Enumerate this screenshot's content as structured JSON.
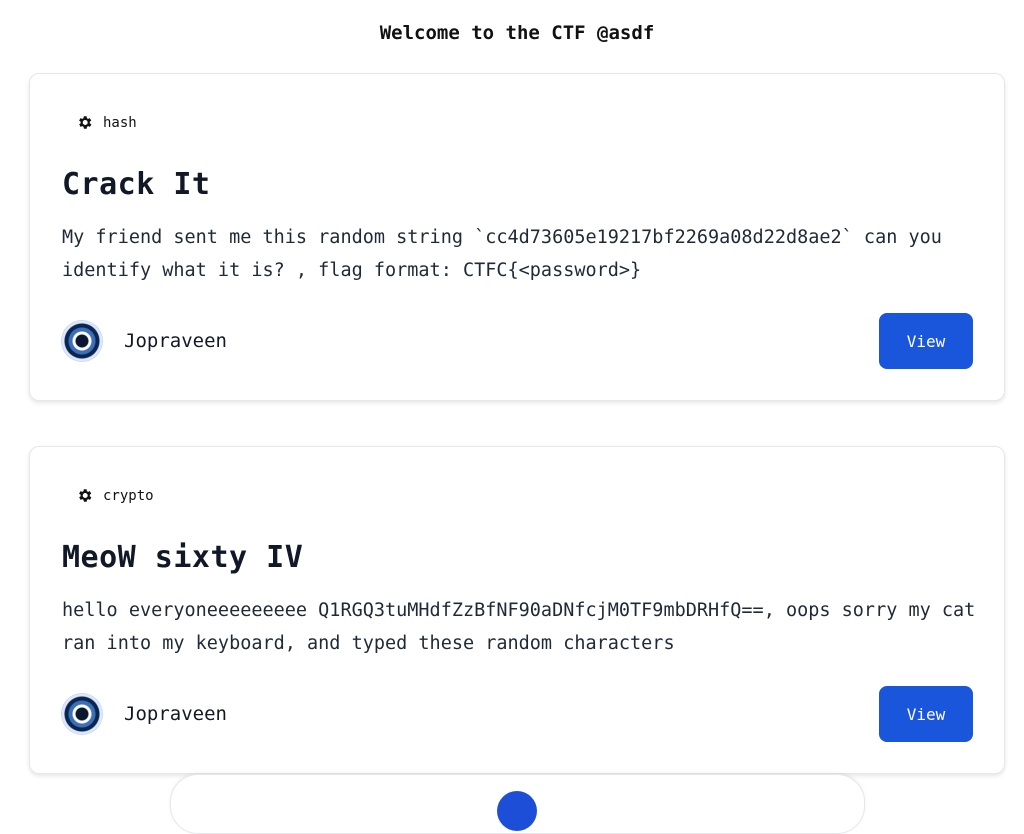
{
  "header": {
    "title": "Welcome to the CTF @asdf"
  },
  "challenges": [
    {
      "category": "hash",
      "category_icon": "gear-icon",
      "title": "Crack It",
      "description": "My friend sent me this random string `cc4d73605e19217bf2269a08d22d8ae2` can you identify what it is? , flag format: CTFC{<password>}",
      "author": "Jopraveen",
      "view_label": "View"
    },
    {
      "category": "crypto",
      "category_icon": "gear-icon",
      "title": "MeoW sixty IV",
      "description": "hello everyoneeeeeeeee Q1RGQ3tuMHdfZzBfNF90aDNfcjM0TF9mbDRHfQ==, oops sorry my cat ran into my keyboard, and typed these random characters",
      "author": "Jopraveen",
      "view_label": "View"
    }
  ],
  "colors": {
    "accent": "#1a56db",
    "card_border": "#e5e7eb",
    "text": "#111827"
  }
}
